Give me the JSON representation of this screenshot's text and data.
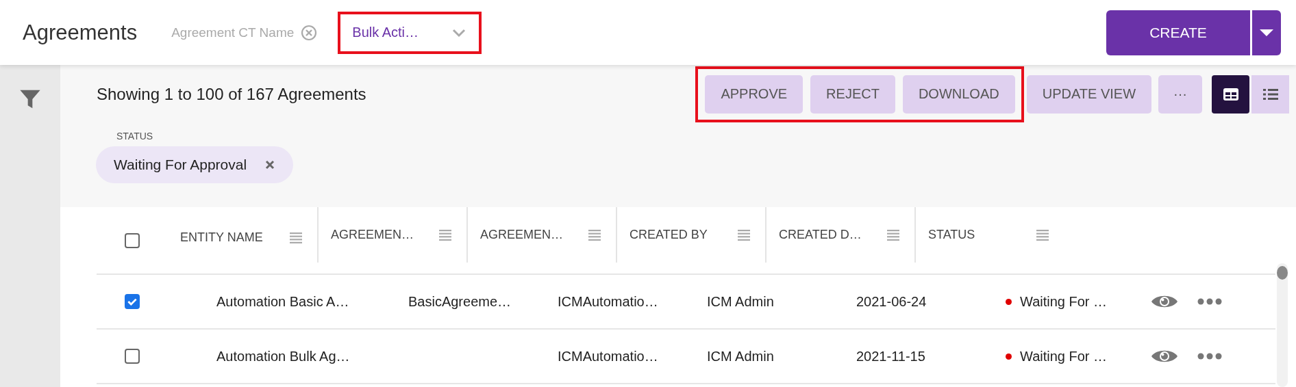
{
  "header": {
    "title": "Agreements",
    "filter_tag": {
      "label": "Agreement CT Name"
    },
    "bulk_actions": {
      "label": "Bulk Acti…",
      "highlighted": true
    },
    "create_button": {
      "label": "CREATE"
    }
  },
  "toolbar": {
    "summary": "Showing 1 to 100 of 167 Agreements",
    "highlighted_actions": [
      "APPROVE",
      "REJECT",
      "DOWNLOAD"
    ],
    "actions": [
      "UPDATE VIEW"
    ],
    "more": "···",
    "views": [
      {
        "kind": "grid",
        "selected": true
      },
      {
        "kind": "list",
        "selected": false
      }
    ]
  },
  "filters": [
    {
      "label": "STATUS",
      "value": "Waiting For Approval"
    }
  ],
  "table": {
    "all_checked": false,
    "columns": [
      "ENTITY NAME",
      "AGREEMEN…",
      "AGREEMEN…",
      "CREATED BY",
      "CREATED D…",
      "STATUS"
    ],
    "rows": [
      {
        "checked": true,
        "cells": [
          "Automation Basic A…",
          "BasicAgreeme…",
          "ICMAutomatio…",
          "ICM Admin",
          "2021-06-24"
        ],
        "status": "Waiting For …",
        "color": "#e00000"
      },
      {
        "checked": false,
        "cells": [
          "Automation Bulk Ag…",
          "",
          "ICMAutomatio…",
          "ICM Admin",
          "2021-11-15"
        ],
        "status": "Waiting For …",
        "color": "#e00000"
      }
    ]
  }
}
